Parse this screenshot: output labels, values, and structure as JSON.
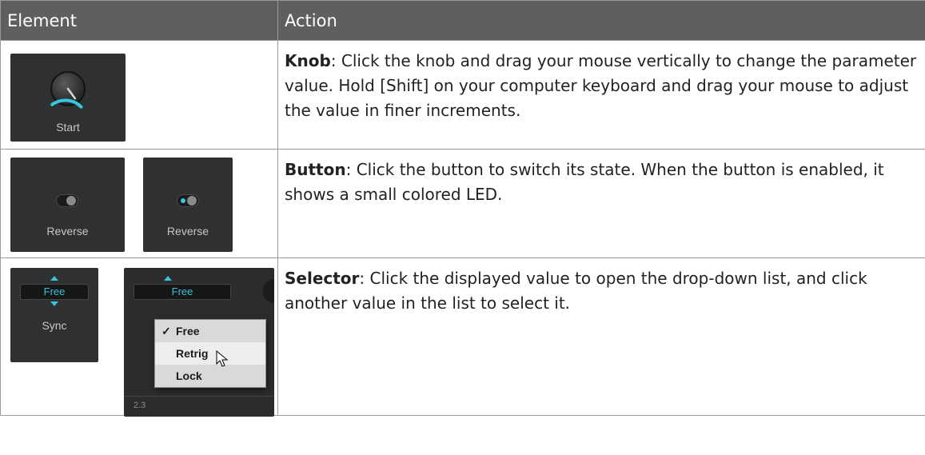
{
  "table": {
    "headers": {
      "element": "Element",
      "action": "Action"
    },
    "rows": [
      {
        "element": {
          "knob_label": "Start",
          "knob_value_fraction": 0.3,
          "accent_color": "#34c8e0"
        },
        "action": {
          "term": "Knob",
          "text": ": Click the knob and drag your mouse vertically to change the parameter value. Hold [Shift] on your computer keyboard and drag your mouse to adjust the value in finer increments."
        }
      },
      {
        "element": {
          "off_label": "Reverse",
          "on_label": "Reverse"
        },
        "action": {
          "term": "Button",
          "text": ": Click the button to switch its state. When the button is enabled, it shows a small colored LED."
        }
      },
      {
        "element": {
          "closed_value": "Free",
          "closed_label": "Sync",
          "open_value": "Free",
          "options": [
            "Free",
            "Retrig",
            "Lock"
          ],
          "checked_option": "Free",
          "hovered_option": "Retrig",
          "background_numbers": "2.3"
        },
        "action": {
          "term": "Selector",
          "text": ": Click the displayed value to open the drop-down list, and click another value in the list to select it."
        }
      }
    ]
  },
  "icons": [
    "knob-icon",
    "toggle-off-icon",
    "toggle-on-icon",
    "arrow-up-icon",
    "arrow-down-icon",
    "checkmark-icon",
    "mouse-cursor-icon"
  ]
}
